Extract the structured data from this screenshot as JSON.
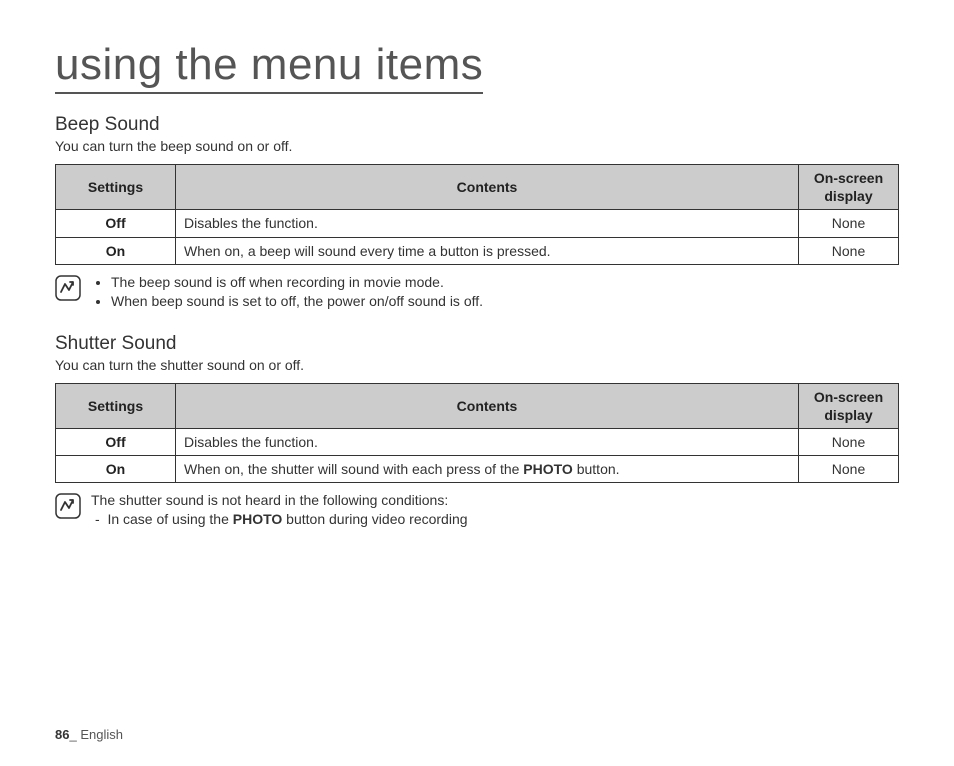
{
  "page_title": "using the menu items",
  "sections": {
    "beep": {
      "title": "Beep Sound",
      "desc": "You can turn the beep sound on or off.",
      "headers": {
        "settings": "Settings",
        "contents": "Contents",
        "display": "On-screen display"
      },
      "rows": [
        {
          "setting": "Off",
          "content": "Disables the function.",
          "display": "None"
        },
        {
          "setting": "On",
          "content": "When on, a beep will sound every time a button is pressed.",
          "display": "None"
        }
      ],
      "notes": [
        "The beep sound is off when recording in movie mode.",
        "When beep sound is set to off, the power on/off sound is off."
      ]
    },
    "shutter": {
      "title": "Shutter Sound",
      "desc": "You can turn the shutter sound on or off.",
      "headers": {
        "settings": "Settings",
        "contents": "Contents",
        "display": "On-screen display"
      },
      "rows": [
        {
          "setting": "Off",
          "content": "Disables the function.",
          "display": "None"
        },
        {
          "setting": "On",
          "content_pre": "When on, the shutter will sound with each press of the ",
          "content_bold": "PHOTO",
          "content_post": " button.",
          "display": "None"
        }
      ],
      "note_intro": "The shutter sound is not heard in the following conditions:",
      "note_item_pre": "In case of using the ",
      "note_item_bold": "PHOTO",
      "note_item_post": " button during video recording"
    }
  },
  "footer": {
    "page": "86",
    "sep": "_ ",
    "lang": "English"
  }
}
